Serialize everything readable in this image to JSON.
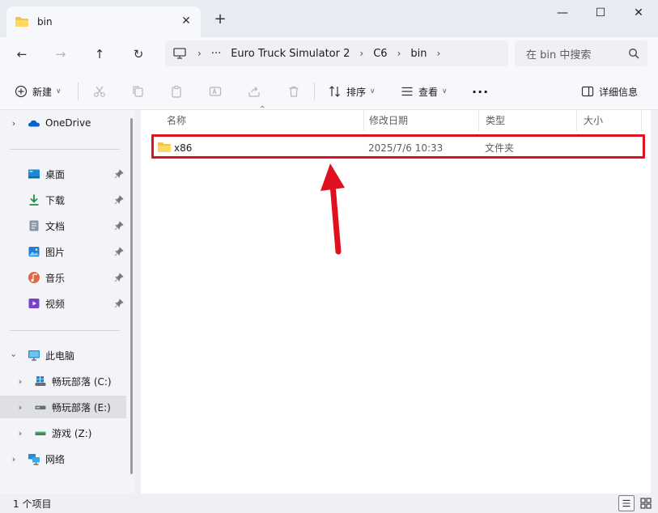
{
  "window": {
    "tab_title": "bin",
    "tab_close": "✕",
    "new_tab": "+",
    "minimize": "—",
    "maximize": "☐",
    "close": "✕"
  },
  "nav": {
    "back": "←",
    "forward": "→",
    "up": "↑",
    "refresh": "↻",
    "breadcrumbs": [
      "Euro Truck Simulator 2",
      "C6",
      "bin"
    ],
    "ellipsis": "···",
    "sep": "›",
    "search_placeholder": "在 bin 中搜索"
  },
  "toolbar": {
    "new_label": "新建",
    "sort_label": "排序",
    "view_label": "查看",
    "more": "···",
    "details_label": "详细信息"
  },
  "sidebar": {
    "onedrive": "OneDrive",
    "quick": [
      "桌面",
      "下载",
      "文档",
      "图片",
      "音乐",
      "视频"
    ],
    "this_pc": "此电脑",
    "drives": [
      "畅玩部落 (C:)",
      "畅玩部落 (E:)",
      "游戏 (Z:)"
    ],
    "network": "网络"
  },
  "columns": [
    "名称",
    "修改日期",
    "类型",
    "大小"
  ],
  "files": [
    {
      "name": "x86",
      "modified": "2025/7/6 10:33",
      "type": "文件夹",
      "size": ""
    }
  ],
  "status": {
    "item_count": "1 个项目"
  },
  "colors": {
    "highlight": "#e0111f",
    "folder": "#f5c445",
    "accent": "#0067c0"
  }
}
